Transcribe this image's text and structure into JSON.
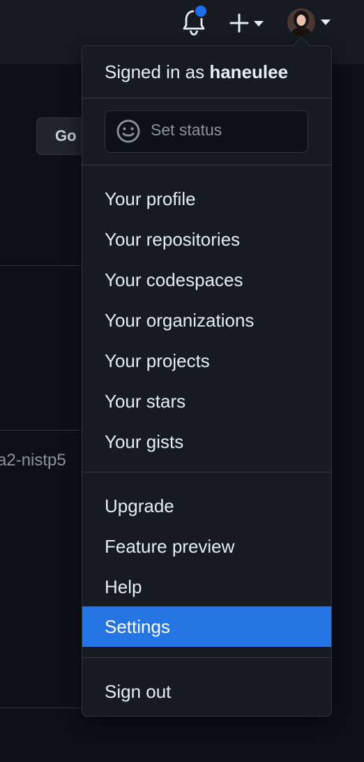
{
  "header": {
    "notifications_icon": "bell-icon",
    "create_icon": "plus-icon",
    "avatar_alt": "avatar"
  },
  "background": {
    "go_button": "Go",
    "partial_text": "a2-nistp5"
  },
  "dropdown": {
    "signed_in_prefix": "Signed in as",
    "username": "haneulee",
    "status_placeholder": "Set status",
    "group1": [
      "Your profile",
      "Your repositories",
      "Your codespaces",
      "Your organizations",
      "Your projects",
      "Your stars",
      "Your gists"
    ],
    "group2": [
      "Upgrade",
      "Feature preview",
      "Help",
      "Settings"
    ],
    "sign_out": "Sign out",
    "active_item": "Settings"
  },
  "colors": {
    "accent": "#2675e4",
    "notification_dot": "#1f6feb",
    "page_bg": "#0d1117",
    "menu_bg": "#161b22",
    "border": "#30363d"
  }
}
